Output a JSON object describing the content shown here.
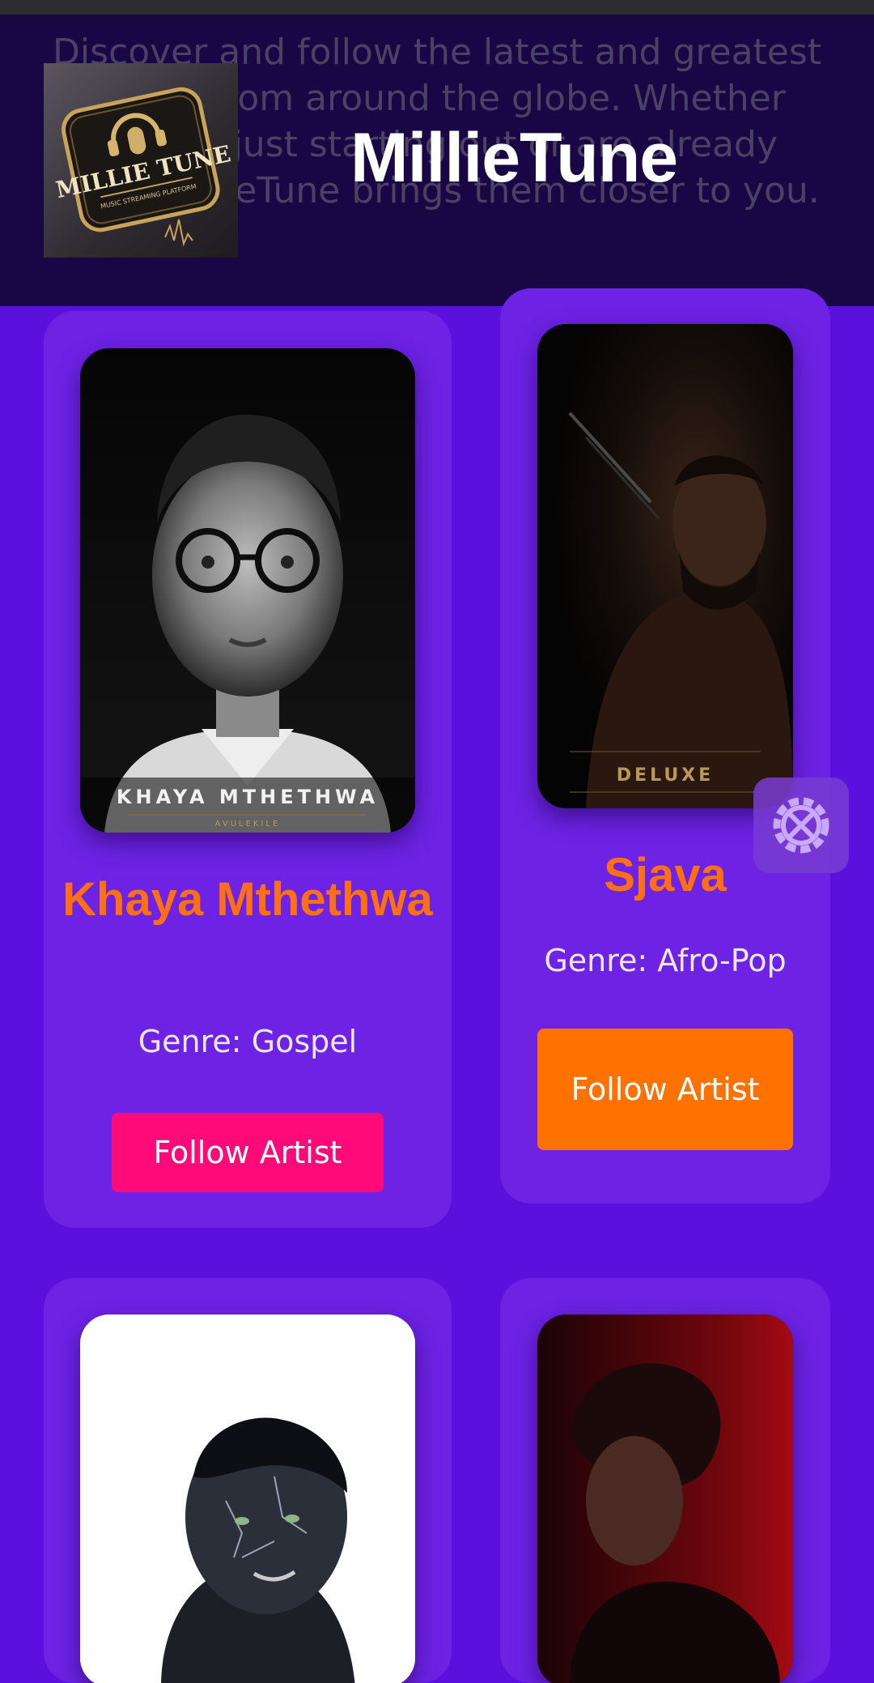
{
  "header": {
    "intro_text": "Discover and follow the latest and greatest artists from around the globe. Whether they're just starting out or are already stars, MillieTune brings them closer to you.",
    "brand_title": "MillieTune",
    "logo": {
      "icon": "millietune-logo",
      "text_line1": "MILLIE TUNE",
      "text_line2": "MUSIC STREAMING PLATFORM"
    }
  },
  "artists": [
    {
      "name": "Khaya Mthethwa",
      "genre": "Genre: Gospel",
      "button_label": "Follow Artist",
      "button_color": "#ff0a79",
      "cover_text": "KHAYA MTHETHWA",
      "cover_subtext": "AVULEKILE"
    },
    {
      "name": "Sjava",
      "genre": "Genre: Afro-Pop",
      "button_label": "Follow Artist",
      "button_color": "#ff7201",
      "cover_text": "DELUXE"
    },
    {
      "name": "",
      "genre": "",
      "button_label": ""
    },
    {
      "name": "",
      "genre": "",
      "button_label": ""
    }
  ],
  "floating_button": {
    "icon": "settings-tools-icon"
  },
  "colors": {
    "page_background": "#5b10de",
    "header_background": "#180645",
    "card_background": "#6d22e4",
    "artist_name": "#ff7014"
  }
}
